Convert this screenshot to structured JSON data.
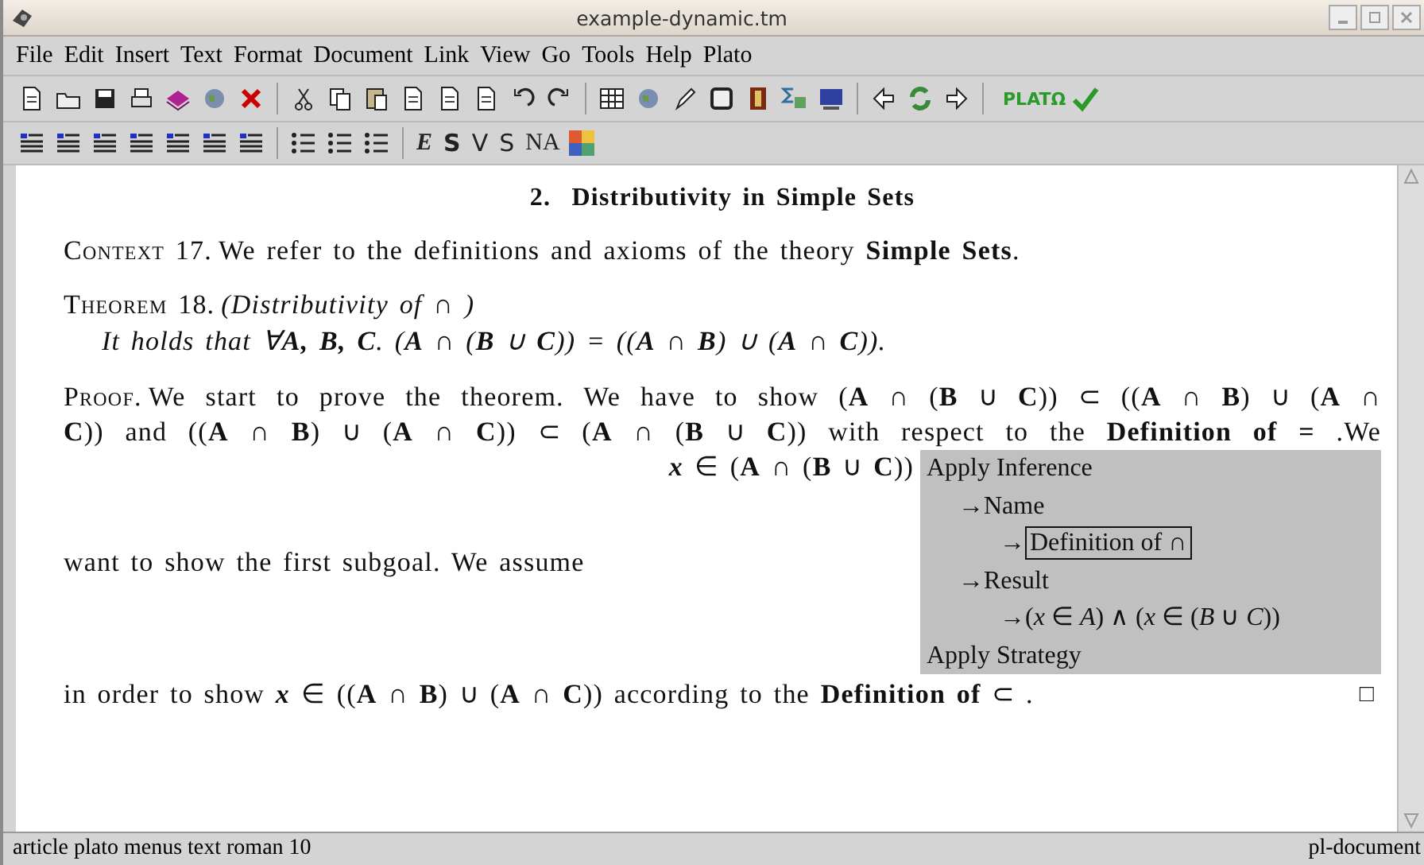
{
  "window": {
    "title": "example-dynamic.tm"
  },
  "menu": [
    "File",
    "Edit",
    "Insert",
    "Text",
    "Format",
    "Document",
    "Link",
    "View",
    "Go",
    "Tools",
    "Help",
    "Plato"
  ],
  "plato_logo": "PLATΩ",
  "format_buttons": [
    {
      "label": "E",
      "kind": "italic"
    },
    {
      "label": "S",
      "kind": "bold"
    },
    {
      "label": "V",
      "kind": "sans"
    },
    {
      "label": "S",
      "kind": "sans"
    },
    {
      "label": "NA",
      "kind": "smallcaps"
    }
  ],
  "document": {
    "heading": "2.  Distributivity in Simple Sets",
    "context": {
      "label": "Context 17.",
      "text": "We refer to the definitions and axioms of the theory **Simple Sets**."
    },
    "theorem": {
      "label": "Theorem 18.",
      "title": "(Distributivity of  ∩ )",
      "statement": "It holds that ∀**A, B, C**. (**A** ∩ (**B** ∪ **C**)) = ((**A** ∩ **B**) ∪ (**A** ∩ **C**))."
    },
    "proof": {
      "label": "Proof.",
      "lines": [
        "We start to prove the theorem. We have to show (**A** ∩ (**B** ∪ **C**)) ⊂ ((**A** ∩ **B**) ∪ (**A** ∩",
        "**C**)) and ((**A** ∩ **B**) ∪ (**A** ∩ **C**)) ⊂ (**A** ∩ (**B** ∪ **C**)) with respect to the **Definition of =**  .We"
      ],
      "formula": "*x* ∈ (**A** ∩ (**B** ∪ **C**))",
      "subgoal_text": "want to show the first subgoal. We assume",
      "tactic_box": [
        {
          "text": "Apply Inference",
          "boxed": false,
          "children": [
            {
              "text": "→Name",
              "boxed": false,
              "children": [
                {
                  "text": "→",
                  "boxed": false
                },
                {
                  "text": "Definition of ∩",
                  "boxed": true
                }
              ]
            },
            {
              "text": "→Result",
              "boxed": false,
              "children": [
                {
                  "text": "→(*x* ∈ *A*) ∧ (*x* ∈ (*B* ∪ *C*))",
                  "boxed": false
                }
              ]
            }
          ]
        },
        {
          "text": "Apply Strategy",
          "boxed": false
        }
      ],
      "final_line": "in order to show *x* ∈ ((**A** ∩ **B**) ∪ (**A** ∩ **C**)) according to the **Definition of** ⊂  .",
      "qed": "□"
    }
  },
  "status_bar": {
    "left": "article plato menus text roman 10",
    "right": "pl-document"
  }
}
